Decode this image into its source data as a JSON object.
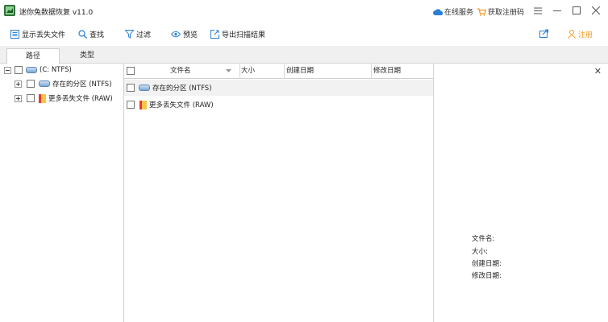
{
  "window": {
    "title": "迷你兔数据恢复 v11.0",
    "online_service": "在线服务",
    "buy_code": "获取注册码"
  },
  "toolbar": {
    "show_lost": "显示丢失文件",
    "find": "查找",
    "filter": "过滤",
    "preview": "预览",
    "export": "导出扫描结果",
    "register": "注册"
  },
  "tabs": [
    "路径",
    "类型"
  ],
  "tree": {
    "root": "(C: NTFS)",
    "items": [
      "存在的分区 (NTFS)",
      "更多丢失文件 (RAW)"
    ]
  },
  "list": {
    "columns": [
      "文件名",
      "大小",
      "创建日期",
      "修改日期"
    ],
    "rows": [
      "存在的分区 (NTFS)",
      "更多丢失文件 (RAW)"
    ]
  },
  "preview": {
    "labels": [
      "文件名:",
      "大小:",
      "创建日期:",
      "修改日期:"
    ]
  },
  "colors": {
    "accent": "#2a7fd4",
    "orange": "#f39a1e"
  }
}
